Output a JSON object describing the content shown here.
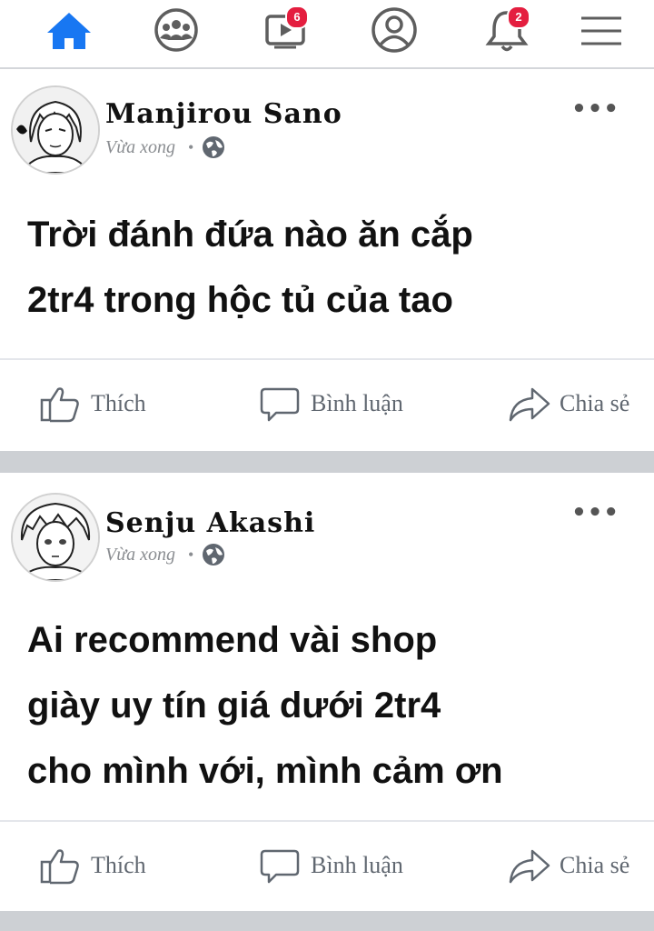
{
  "nav": {
    "items": [
      {
        "name": "home",
        "badge": ""
      },
      {
        "name": "groups",
        "badge": ""
      },
      {
        "name": "watch",
        "badge": "6"
      },
      {
        "name": "profile",
        "badge": ""
      },
      {
        "name": "notifications",
        "badge": "2"
      },
      {
        "name": "menu",
        "badge": ""
      }
    ],
    "active_color": "#1877f2",
    "icon_color": "#5e5e5e"
  },
  "posts": [
    {
      "author": "Manjirou Sano",
      "time": "Vừa xong",
      "privacy_icon": "globe-icon",
      "content_lines": [
        "Trời đánh đứa nào ăn cắp",
        "2tr4 trong hộc tủ của tao"
      ]
    },
    {
      "author": "Senju Akashi",
      "time": "Vừa xong",
      "privacy_icon": "globe-icon",
      "content_lines": [
        "Ai recommend vài shop",
        "giày uy tín giá dưới 2tr4",
        "cho mình với, mình cảm ơn"
      ]
    }
  ],
  "actions": {
    "like": "Thích",
    "comment": "Bình luận",
    "share": "Chia sẻ"
  },
  "more_label": "•••"
}
